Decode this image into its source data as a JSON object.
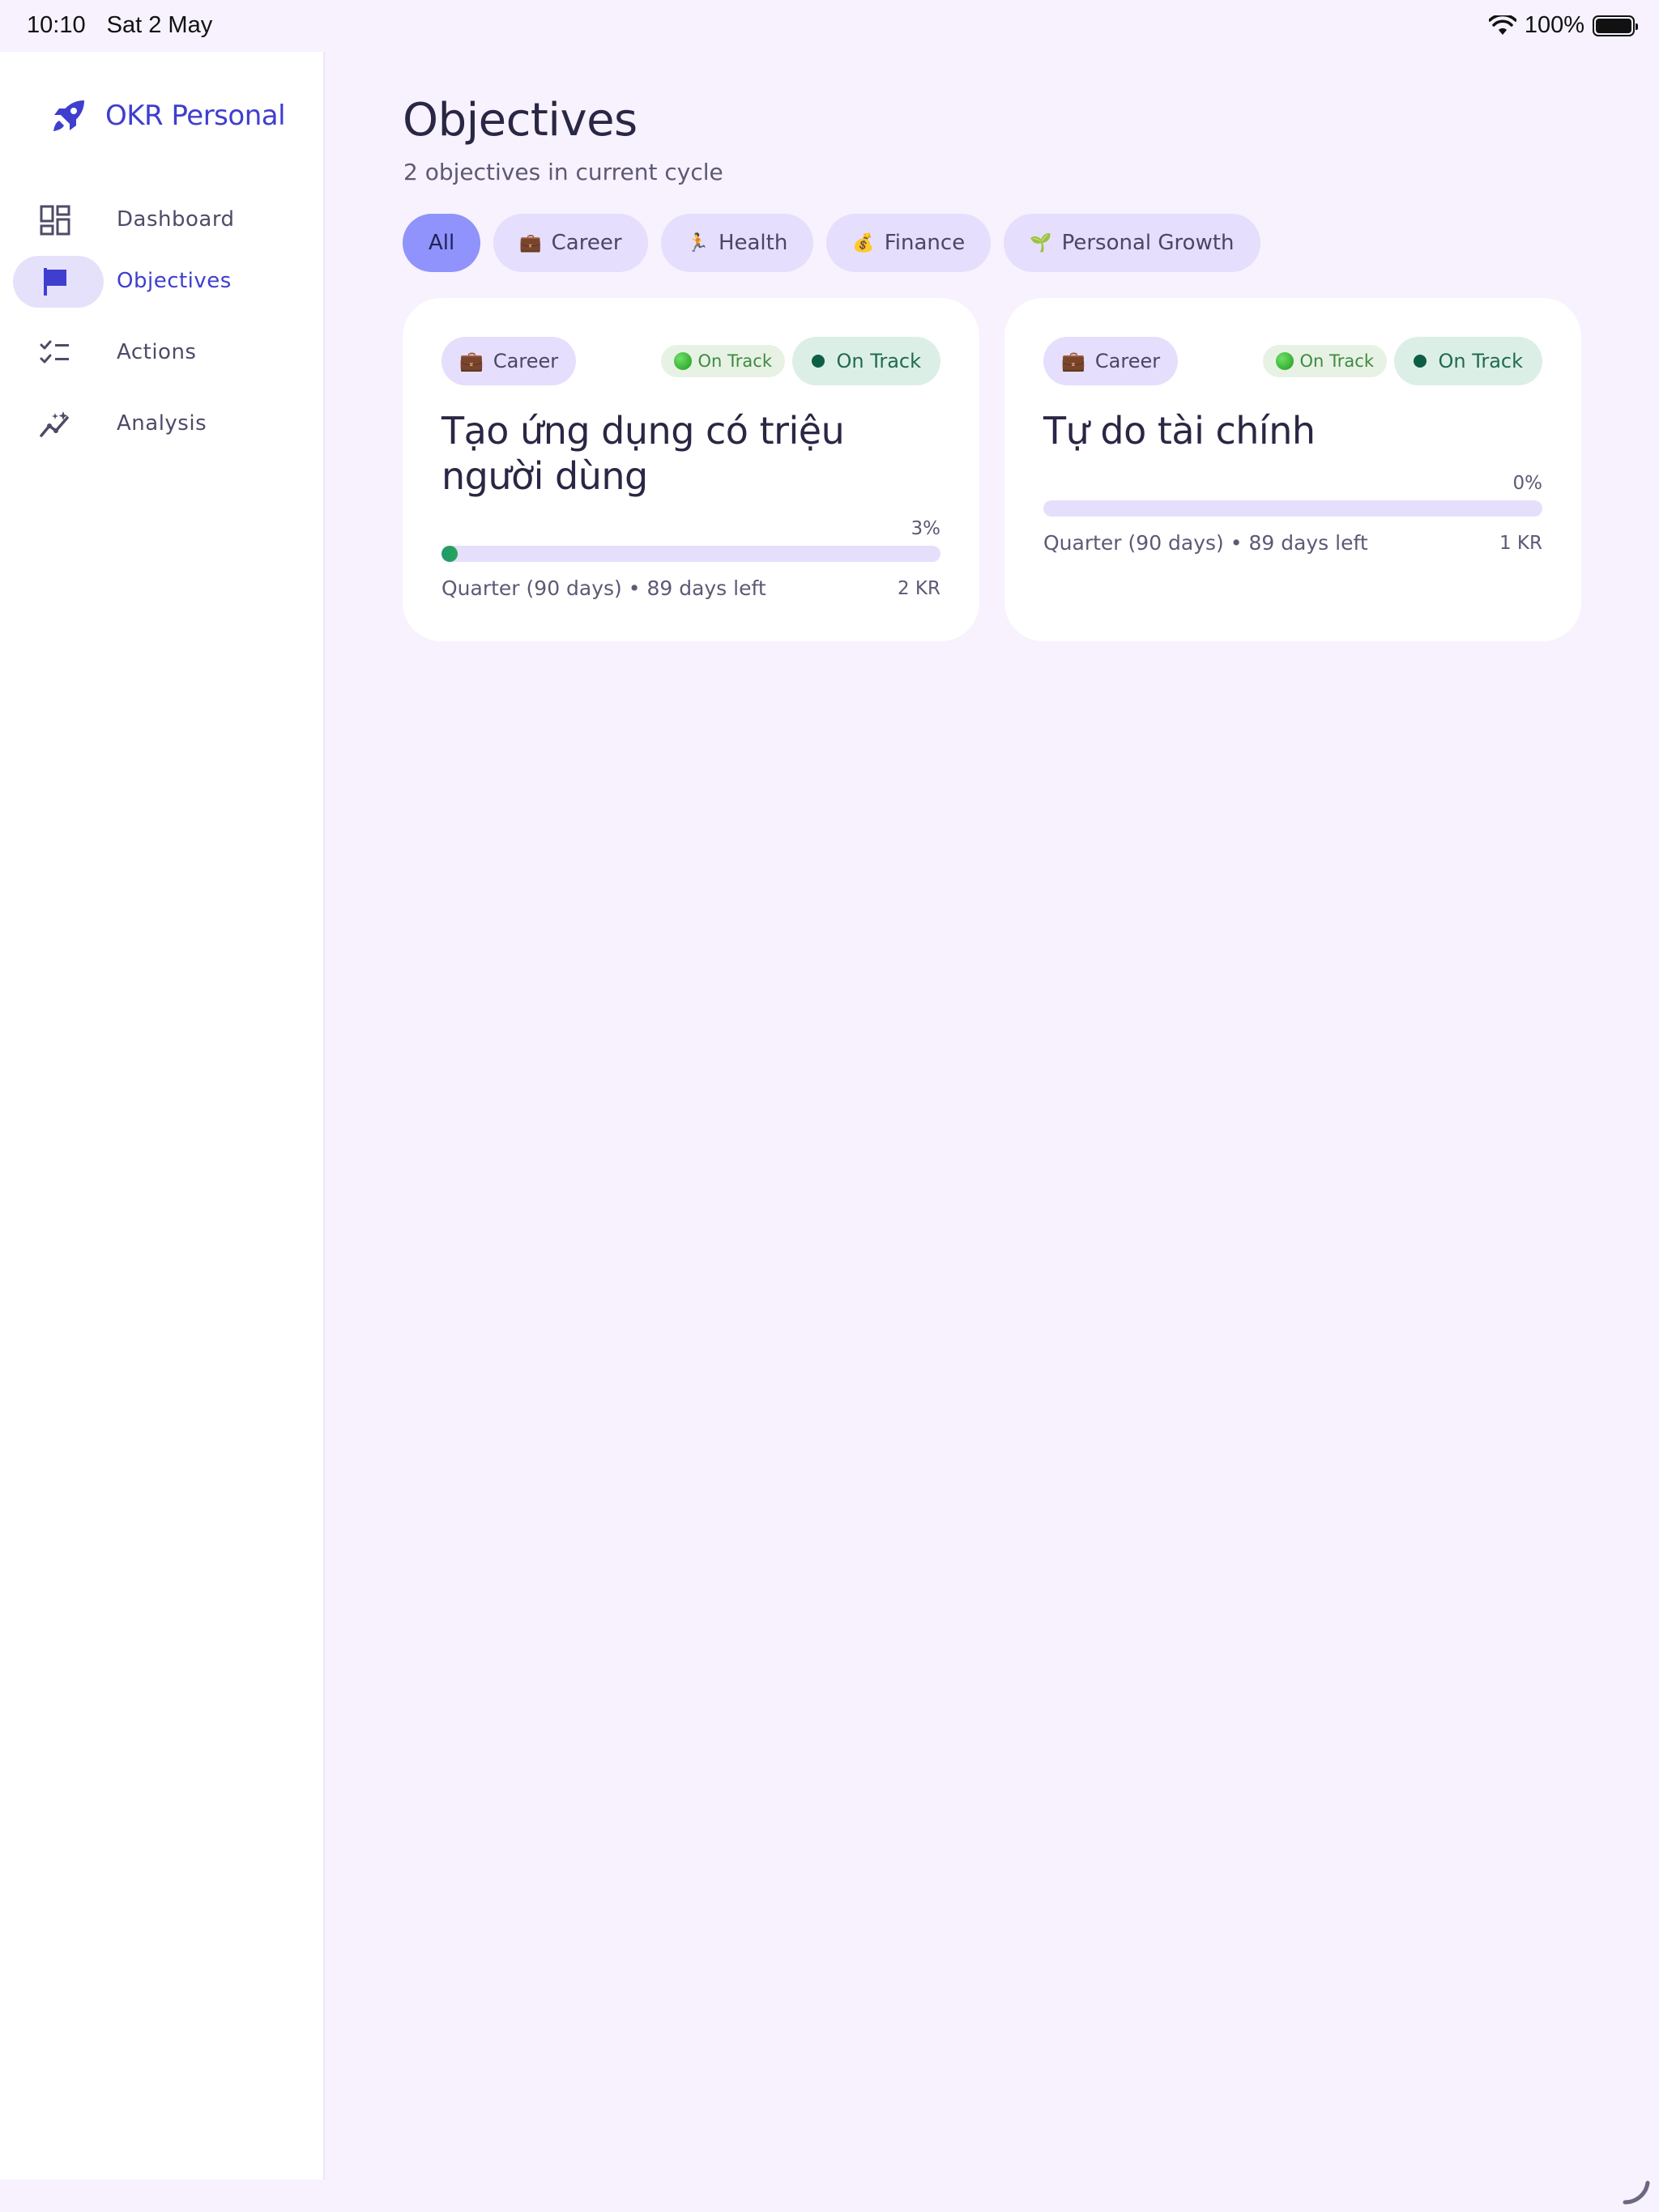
{
  "status_bar": {
    "time": "10:10",
    "date": "Sat 2 May",
    "battery": "100%"
  },
  "sidebar": {
    "brand": "OKR Personal",
    "items": [
      {
        "label": "Dashboard",
        "icon": "dashboard-icon",
        "active": false
      },
      {
        "label": "Objectives",
        "icon": "flag-icon",
        "active": true
      },
      {
        "label": "Actions",
        "icon": "checklist-icon",
        "active": false
      },
      {
        "label": "Analysis",
        "icon": "analytics-icon",
        "active": false
      }
    ]
  },
  "main": {
    "title": "Objectives",
    "subtitle": "2 objectives in current cycle",
    "filters": [
      {
        "label": "All",
        "icon": "",
        "active": true
      },
      {
        "label": "Career",
        "icon": "💼",
        "active": false
      },
      {
        "label": "Health",
        "icon": "🏃",
        "active": false
      },
      {
        "label": "Finance",
        "icon": "💰",
        "active": false
      },
      {
        "label": "Personal Growth",
        "icon": "🌱",
        "active": false
      }
    ],
    "objectives": [
      {
        "category": "Career",
        "category_icon": "💼",
        "status_small": "On Track",
        "status_large": "On Track",
        "title": "Tạo ứng dụng có triệu người dùng",
        "progress": 0.03,
        "progress_label": "3%",
        "meta": "Quarter (90 days) • 89 days left",
        "kr_count": "2 KR"
      },
      {
        "category": "Career",
        "category_icon": "💼",
        "status_small": "On Track",
        "status_large": "On Track",
        "title": "Tự do tài chính",
        "progress": 0,
        "progress_label": "0%",
        "meta": "Quarter (90 days) • 89 days left",
        "kr_count": "1 KR"
      }
    ]
  },
  "colors": {
    "accent": "#3f3ecf",
    "chip_active": "#8f93fb",
    "chip": "#e5defc",
    "on_track": "#0e5e46"
  }
}
